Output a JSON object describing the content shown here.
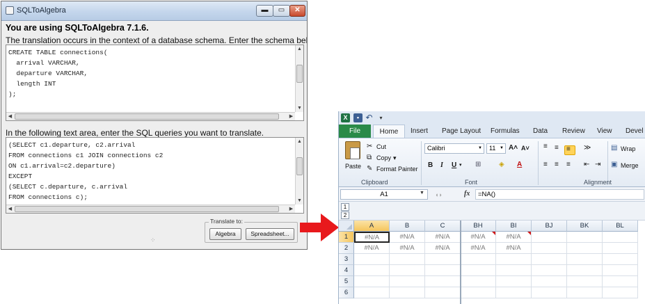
{
  "sql_window": {
    "title": "SQLToAlgebra",
    "title_buttons": {
      "minimize": "▬",
      "maximize": "▭",
      "close": "✕"
    },
    "headline": "You are using SQLToAlgebra 7.1.6.",
    "schema_instruction": "The translation occurs in the context of a database schema. Enter the schema below",
    "schema_text": "CREATE TABLE connections(\n  arrival VARCHAR,\n  departure VARCHAR,\n  length INT\n);",
    "query_instruction": "In the following text area, enter the SQL queries you want to translate.",
    "query_text": "(SELECT c1.departure, c2.arrival\nFROM connections c1 JOIN connections c2\nON c1.arrival=c2.departure)\nEXCEPT\n(SELECT c.departure, c.arrival\nFROM connections c);",
    "translate_group": {
      "legend": "Translate to:",
      "algebra_button": "Algebra",
      "spreadsheet_button": "Spreadsheet..."
    }
  },
  "arrow_color": "#e8191c",
  "excel": {
    "quick_access": {
      "app_icon": "X",
      "save_icon": "▪",
      "undo_icon": "↶",
      "menu_icon": "▾"
    },
    "tabs": [
      "File",
      "Home",
      "Insert",
      "Page Layout",
      "Formulas",
      "Data",
      "Review",
      "View",
      "Devel"
    ],
    "clipboard": {
      "cut": "Cut",
      "copy": "Copy",
      "copy_arrow": "▾",
      "paste": "Paste",
      "format_painter": "Format Painter",
      "label": "Clipboard"
    },
    "font": {
      "name": "Calibri",
      "size": "11",
      "grow": "A˄",
      "shrink": "A˅",
      "bold": "B",
      "italic": "I",
      "underline": "U",
      "underline_arrow": "▾",
      "border": "⊞",
      "fill": "◈",
      "font_color": "A",
      "label": "Font"
    },
    "alignment": {
      "wrap": "Wrap",
      "merge": "Merge",
      "label": "Alignment",
      "top_align": "≡",
      "middle_align": "≡",
      "bottom_align": "≡",
      "left_align": "≡",
      "center_align": "≡",
      "right_align": "≡",
      "orientation": "≫",
      "decrease_indent": "⇤",
      "increase_indent": "⇥"
    },
    "name_box": "A1",
    "formula": "=NA()",
    "fx": "fx",
    "outline_levels": [
      "1",
      "2"
    ],
    "columns": [
      "A",
      "B",
      "C",
      "BH",
      "BI",
      "BJ",
      "BK",
      "BL"
    ],
    "rows": [
      "1",
      "2",
      "3",
      "4",
      "5",
      "6"
    ],
    "cell_values": [
      [
        "#N/A",
        "#N/A",
        "#N/A",
        "#N/A",
        "#N/A",
        "",
        "",
        ""
      ],
      [
        "#N/A",
        "#N/A",
        "#N/A",
        "#N/A",
        "#N/A",
        "",
        "",
        ""
      ]
    ],
    "brand_color": "#2a8a48"
  }
}
